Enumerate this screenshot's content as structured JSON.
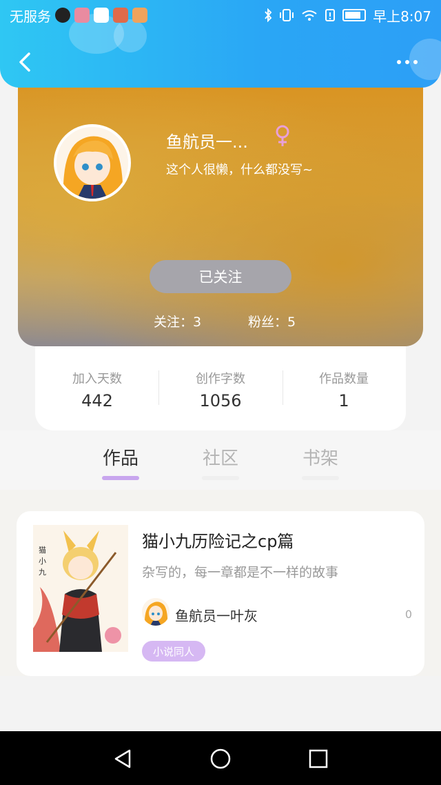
{
  "status_bar": {
    "carrier": "无服务",
    "time": "早上8:07"
  },
  "header": {
    "back_icon": "chevron-left-icon",
    "more_icon": "more-dots-icon"
  },
  "profile": {
    "username": "鱼航员一...",
    "gender_icon": "female-symbol-icon",
    "gender_color": "#e9a0d8",
    "bio": "这个人很懒，什么都没写~",
    "follow_button": "已关注",
    "following": "关注：3",
    "followers": "粉丝：5"
  },
  "stats": [
    {
      "label": "加入天数",
      "value": "442"
    },
    {
      "label": "创作字数",
      "value": "1056"
    },
    {
      "label": "作品数量",
      "value": "1"
    }
  ],
  "tabs": [
    {
      "label": "作品",
      "active": true
    },
    {
      "label": "社区",
      "active": false
    },
    {
      "label": "书架",
      "active": false
    }
  ],
  "work": {
    "title": "猫小九历险记之cp篇",
    "description": "杂写的，每一章都是不一样的故事",
    "author": "鱼航员一叶灰",
    "count": "0",
    "tag": "小说同人",
    "cover_text": "猫小九"
  },
  "system_nav": {
    "back_icon": "triangle-back-icon",
    "home_icon": "circle-home-icon",
    "recent_icon": "square-recent-icon"
  },
  "colors": {
    "header_start": "#2fc7f3",
    "header_end": "#2d9ff6",
    "accent_purple": "#c8a6ee",
    "tag_bg": "#d6b8f3",
    "follow_btn": "#a6a5ab"
  }
}
